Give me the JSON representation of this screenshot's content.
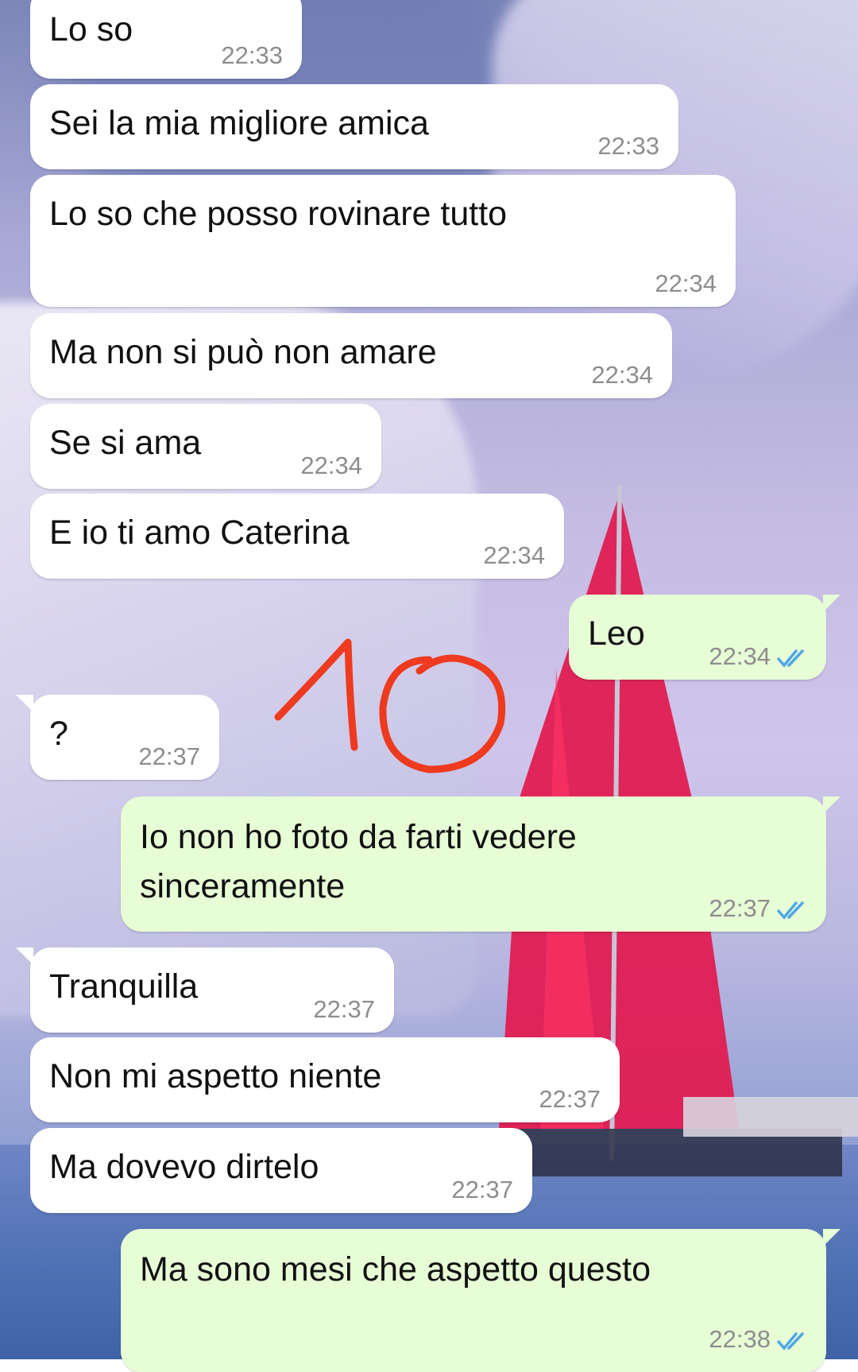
{
  "messages": [
    {
      "direction": "in",
      "text": "Lo so",
      "time": "22:33"
    },
    {
      "direction": "in",
      "text": "Sei la mia migliore amica",
      "time": "22:33"
    },
    {
      "direction": "in",
      "text": "Lo so che posso rovinare tutto",
      "time": "22:34"
    },
    {
      "direction": "in",
      "text": "Ma non si può non amare",
      "time": "22:34"
    },
    {
      "direction": "in",
      "text": "Se si ama",
      "time": "22:34"
    },
    {
      "direction": "in",
      "text": "E io ti amo Caterina",
      "time": "22:34"
    },
    {
      "direction": "out",
      "text": "Leo",
      "time": "22:34",
      "status": "read"
    },
    {
      "direction": "in",
      "text": "?",
      "time": "22:37"
    },
    {
      "direction": "out",
      "text": "Io non ho foto da farti vedere sinceramente",
      "time": "22:37",
      "status": "read"
    },
    {
      "direction": "in",
      "text": "Tranquilla",
      "time": "22:37"
    },
    {
      "direction": "in",
      "text": "Non mi aspetto niente",
      "time": "22:37"
    },
    {
      "direction": "in",
      "text": "Ma dovevo dirtelo",
      "time": "22:37"
    },
    {
      "direction": "out",
      "text": "Ma sono mesi che aspetto questo",
      "time": "22:38",
      "status": "read"
    }
  ],
  "annotation": {
    "text": "10",
    "color": "#ee3a1f"
  },
  "colors": {
    "incoming_bubble": "#ffffff",
    "outgoing_bubble": "#e7fdd6",
    "read_ticks": "#4fa6e8",
    "timestamp": "#8d8d8d"
  }
}
